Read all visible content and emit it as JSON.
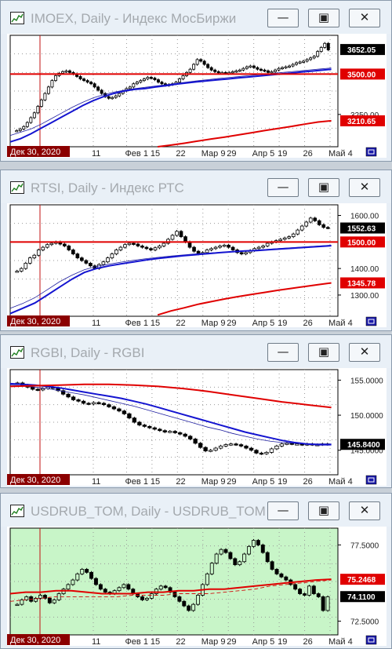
{
  "windows": [
    {
      "title": "IMOEX, Daily - Индекс МосБиржи",
      "chart_data": {
        "type": "candlestick",
        "instrument": "IMOEX",
        "timeframe": "Daily",
        "x_labels": [
          "11",
          "Фев 1",
          "15",
          "22",
          "Мар 9",
          "29",
          "Апр 5",
          "19",
          "26",
          "Май 4"
        ],
        "cursor_date": "Дек 30, 2020",
        "y_ticks": [
          "3250.00"
        ],
        "price_labels": [
          {
            "text": "3652.05",
            "value": 3652.05,
            "color": "#000000",
            "kind": "last"
          },
          {
            "text": "3500.00",
            "value": 3500.0,
            "color": "#e00000",
            "kind": "level"
          },
          {
            "text": "3210.65",
            "value": 3210.65,
            "color": "#e00000",
            "kind": "ma"
          }
        ],
        "ylim": [
          3050,
          3740
        ],
        "horizontal_level": 3500.0,
        "grid": "dotted",
        "background": "#ffffff",
        "close": [
          3150,
          3160,
          3175,
          3200,
          3230,
          3260,
          3300,
          3340,
          3380,
          3420,
          3460,
          3490,
          3505,
          3515,
          3520,
          3510,
          3500,
          3485,
          3470,
          3460,
          3450,
          3440,
          3420,
          3400,
          3380,
          3360,
          3350,
          3355,
          3365,
          3380,
          3395,
          3410,
          3420,
          3440,
          3450,
          3460,
          3470,
          3480,
          3475,
          3465,
          3450,
          3440,
          3430,
          3435,
          3440,
          3450,
          3470,
          3490,
          3510,
          3530,
          3560,
          3590,
          3580,
          3560,
          3540,
          3525,
          3515,
          3510,
          3510,
          3505,
          3510,
          3515,
          3520,
          3525,
          3535,
          3545,
          3550,
          3540,
          3530,
          3525,
          3520,
          3510,
          3515,
          3525,
          3535,
          3540,
          3545,
          3550,
          3560,
          3570,
          3575,
          3580,
          3590,
          3600,
          3610,
          3640,
          3665,
          3690,
          3650
        ],
        "ma_blue": [
          3080,
          3100,
          3130,
          3165,
          3200,
          3235,
          3270,
          3305,
          3335,
          3360,
          3380,
          3395,
          3405,
          3410,
          3420,
          3428,
          3438,
          3445,
          3452,
          3458,
          3464,
          3470,
          3476,
          3482,
          3488,
          3494,
          3500,
          3506,
          3512,
          3518,
          3524,
          3530
        ],
        "ma_thin": [
          3120,
          3140,
          3160,
          3190,
          3225,
          3260,
          3295,
          3325,
          3352,
          3372,
          3388,
          3400,
          3410,
          3418,
          3426,
          3434,
          3442,
          3450,
          3458,
          3465,
          3472,
          3478,
          3484,
          3490,
          3496,
          3502,
          3508,
          3514,
          3520,
          3526,
          3532,
          3538
        ],
        "ma_red": [
          3050,
          3060,
          3072,
          3085,
          3098,
          3110,
          3123,
          3136,
          3150,
          3163,
          3176,
          3190,
          3203,
          3210.65
        ]
      },
      "footer_icon": "template-icon"
    },
    {
      "title": "RTSI, Daily - Индекс РТС",
      "chart_data": {
        "type": "candlestick",
        "instrument": "RTSI",
        "timeframe": "Daily",
        "x_labels": [
          "11",
          "Фев 1",
          "15",
          "22",
          "Мар 9",
          "29",
          "Апр 5",
          "19",
          "26",
          "Май 4"
        ],
        "cursor_date": "Дек 30, 2020",
        "y_ticks": [
          "1600.00",
          "1400.00",
          "1300.00"
        ],
        "price_labels": [
          {
            "text": "1552.63",
            "value": 1552.63,
            "color": "#000000",
            "kind": "last"
          },
          {
            "text": "1500.00",
            "value": 1500.0,
            "color": "#e00000",
            "kind": "level"
          },
          {
            "text": "1345.78",
            "value": 1345.78,
            "color": "#e00000",
            "kind": "ma"
          }
        ],
        "ylim": [
          1220,
          1640
        ],
        "horizontal_level": 1500.0,
        "grid": "dotted",
        "background": "#ffffff",
        "close": [
          1390,
          1400,
          1420,
          1440,
          1450,
          1470,
          1480,
          1490,
          1495,
          1500,
          1492,
          1485,
          1470,
          1455,
          1440,
          1430,
          1420,
          1410,
          1400,
          1415,
          1425,
          1440,
          1455,
          1470,
          1480,
          1490,
          1495,
          1492,
          1485,
          1480,
          1475,
          1470,
          1478,
          1485,
          1495,
          1510,
          1525,
          1540,
          1520,
          1500,
          1480,
          1465,
          1455,
          1460,
          1470,
          1475,
          1480,
          1485,
          1488,
          1480,
          1470,
          1460,
          1455,
          1460,
          1468,
          1475,
          1480,
          1485,
          1495,
          1500,
          1505,
          1510,
          1515,
          1520,
          1530,
          1545,
          1560,
          1575,
          1590,
          1580,
          1565,
          1555,
          1553
        ],
        "ma_blue": [
          1230,
          1250,
          1270,
          1300,
          1330,
          1360,
          1385,
          1400,
          1410,
          1418,
          1425,
          1432,
          1438,
          1443,
          1448,
          1452,
          1456,
          1460,
          1463,
          1466,
          1468,
          1471,
          1474,
          1477,
          1480,
          1483,
          1486
        ],
        "ma_thin": [
          1250,
          1268,
          1290,
          1320,
          1350,
          1375,
          1395,
          1408,
          1416,
          1424,
          1431,
          1437,
          1442,
          1447,
          1451,
          1455,
          1458,
          1461,
          1464,
          1467,
          1470,
          1473,
          1476,
          1479,
          1482,
          1485,
          1488
        ],
        "ma_red": [
          1225,
          1240,
          1252,
          1265,
          1275,
          1285,
          1294,
          1302,
          1310,
          1318,
          1325,
          1332,
          1339,
          1345.78
        ]
      },
      "footer_icon": "template-icon"
    },
    {
      "title": "RGBI, Daily - RGBI",
      "chart_data": {
        "type": "candlestick",
        "instrument": "RGBI",
        "timeframe": "Daily",
        "x_labels": [
          "11",
          "Фев 1",
          "15",
          "22",
          "Мар 9",
          "29",
          "Апр 5",
          "19",
          "26",
          "Май 4"
        ],
        "cursor_date": "Дек 30, 2020",
        "y_ticks": [
          "155.0000",
          "150.0000",
          "145.0000"
        ],
        "price_labels": [
          {
            "text": "145.8400",
            "value": 145.84,
            "color": "#000000",
            "kind": "last"
          }
        ],
        "ylim": [
          141.5,
          156.5
        ],
        "horizontal_level": null,
        "grid": "dotted",
        "background": "#ffffff",
        "close": [
          154.6,
          154.3,
          154.0,
          153.7,
          153.6,
          153.8,
          154.0,
          153.9,
          153.5,
          153.0,
          152.6,
          152.2,
          152.0,
          151.7,
          151.6,
          151.8,
          151.7,
          151.5,
          151.2,
          150.9,
          150.6,
          150.2,
          149.6,
          149.0,
          148.6,
          148.4,
          148.2,
          148.0,
          147.8,
          147.6,
          147.7,
          147.5,
          147.3,
          147.0,
          146.6,
          146.0,
          145.4,
          144.9,
          145.0,
          145.3,
          145.6,
          145.8,
          145.9,
          145.8,
          145.6,
          145.3,
          145.0,
          144.6,
          144.5,
          144.7,
          145.2,
          145.6,
          145.9,
          146.0,
          145.9,
          145.9,
          145.8,
          145.9,
          145.8,
          145.8,
          145.9,
          145.84
        ],
        "ma_blue": [
          154.5,
          154.4,
          154.3,
          154.1,
          153.9,
          153.6,
          153.3,
          153.0,
          152.7,
          152.4,
          152.0,
          151.6,
          151.1,
          150.6,
          150.1,
          149.6,
          149.1,
          148.6,
          148.1,
          147.6,
          147.2,
          146.8,
          146.4,
          146.1,
          145.9,
          145.8,
          145.8
        ],
        "ma_thin": [
          154.3,
          154.2,
          154.0,
          153.8,
          153.5,
          153.2,
          152.9,
          152.5,
          152.1,
          151.7,
          151.3,
          150.8,
          150.3,
          149.8,
          149.3,
          148.8,
          148.3,
          147.9,
          147.4,
          147.0,
          146.6,
          146.3,
          146.1,
          146.0,
          145.9,
          145.9,
          145.9
        ],
        "ma_red": [
          154.1,
          154.2,
          154.3,
          154.4,
          154.4,
          154.3,
          154.1,
          153.8,
          153.4,
          152.9,
          152.4,
          151.9,
          151.5,
          151.1
        ]
      },
      "footer_icon": "template-icon"
    },
    {
      "title": "USDRUB_TOM, Daily - USDRUB_TOM",
      "chart_data": {
        "type": "candlestick",
        "instrument": "USDRUB_TOM",
        "timeframe": "Daily",
        "x_labels": [
          "11",
          "Фев 1",
          "15",
          "22",
          "Мар 9",
          "29",
          "Апр 5",
          "19",
          "26",
          "Май 4"
        ],
        "cursor_date": "Дек 30, 2020",
        "y_ticks": [
          "77.5000",
          "72.5000"
        ],
        "price_labels": [
          {
            "text": "75.2468",
            "value": 75.2468,
            "color": "#e00000",
            "kind": "ma"
          },
          {
            "text": "74.1100",
            "value": 74.11,
            "color": "#000000",
            "kind": "last"
          }
        ],
        "ylim": [
          71.6,
          78.6
        ],
        "horizontal_level": null,
        "grid": "dotted",
        "background": "#c8f5c8",
        "close": [
          73.6,
          73.9,
          74.1,
          73.8,
          74.0,
          74.2,
          74.0,
          73.7,
          73.9,
          74.3,
          74.6,
          74.9,
          75.2,
          75.6,
          75.9,
          75.7,
          75.3,
          74.9,
          74.6,
          74.4,
          74.3,
          74.5,
          74.7,
          74.9,
          74.6,
          74.3,
          74.1,
          73.9,
          74.0,
          74.3,
          74.6,
          74.8,
          74.7,
          74.4,
          74.1,
          73.8,
          73.5,
          73.2,
          73.6,
          74.2,
          74.9,
          75.6,
          76.3,
          76.9,
          77.2,
          77.0,
          76.6,
          76.2,
          76.4,
          76.9,
          77.4,
          77.8,
          77.5,
          77.0,
          76.4,
          75.9,
          75.6,
          75.4,
          75.2,
          74.9,
          74.6,
          74.3,
          74.2,
          74.8,
          74.3,
          74.1,
          73.2,
          74.1
        ],
        "ma_red": [
          74.3,
          74.4,
          74.4,
          74.5,
          74.5,
          74.4,
          74.3,
          74.3,
          74.3,
          74.4,
          74.4,
          74.5,
          74.5,
          74.6,
          74.6,
          74.7,
          74.8,
          74.9,
          75.0,
          75.1,
          75.2,
          75.2468
        ],
        "ma_red_thin": [
          73.8,
          73.9,
          74.0,
          74.1,
          74.1,
          74.1,
          74.1,
          74.1,
          74.2,
          74.2,
          74.2,
          74.3,
          74.3,
          74.3,
          74.4,
          74.5,
          74.6,
          74.8,
          74.9,
          75.0,
          75.1,
          75.2
        ]
      },
      "footer_icon": "template-icon"
    }
  ]
}
